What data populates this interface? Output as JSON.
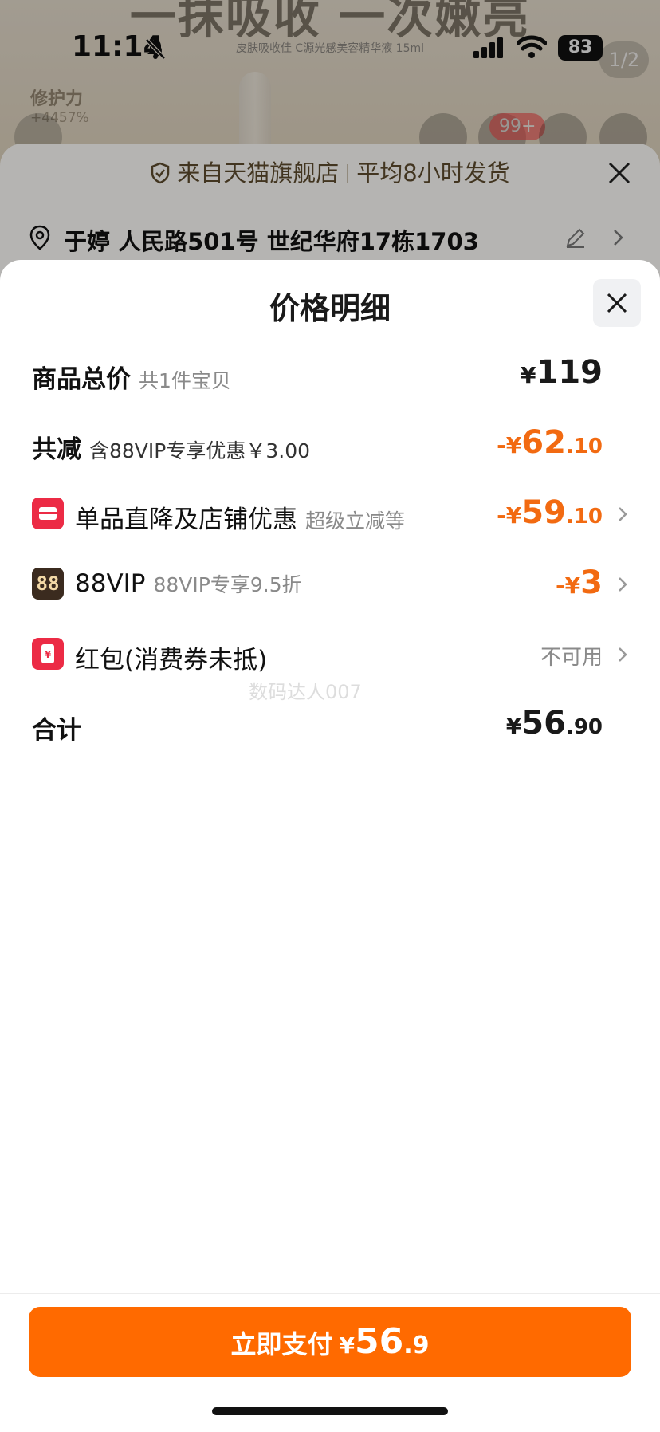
{
  "status_bar": {
    "time": "11:14",
    "battery": "83"
  },
  "background": {
    "headline": "一抹吸收 一次嫩亮",
    "subline": "皮肤吸收佳 C源光感美容精华液 15ml",
    "repair_label": "修护力",
    "repair_pct": "+4457%",
    "page_count": "1/2",
    "badge": "99+"
  },
  "order_sheet": {
    "guarantee_source": "来自天猫旗舰店",
    "guarantee_shipping": "平均8小时发货",
    "address": "于婷 人民路501号 世纪华府17栋1703"
  },
  "panel": {
    "title": "价格明细",
    "rows": {
      "total": {
        "label": "商品总价",
        "sub": "共1件宝贝",
        "currency": "¥",
        "int": "119",
        "dec": ""
      },
      "discount": {
        "label": "共减",
        "sub": "含88VIP专享优惠￥3.00",
        "currency": "-¥",
        "int": "62",
        "dec": ".10"
      },
      "store": {
        "label": "单品直降及店铺优惠",
        "sub": "超级立减等",
        "currency": "-¥",
        "int": "59",
        "dec": ".10"
      },
      "vip": {
        "icon_text": "88",
        "label": "88VIP",
        "sub": "88VIP专享9.5折",
        "currency": "-¥",
        "int": "3",
        "dec": ""
      },
      "redpacket": {
        "label": "红包(消费券未抵)",
        "status": "不可用"
      },
      "sum": {
        "label": "合计",
        "currency": "¥",
        "int": "56",
        "dec": ".90"
      }
    },
    "watermark": "数码达人007"
  },
  "pay_button": {
    "label": "立即支付",
    "currency": "¥",
    "int": "56",
    "dec": ".9"
  },
  "colors": {
    "accent": "#ff6a00",
    "discount": "#f26a11",
    "badge_red": "#ec2b45"
  }
}
